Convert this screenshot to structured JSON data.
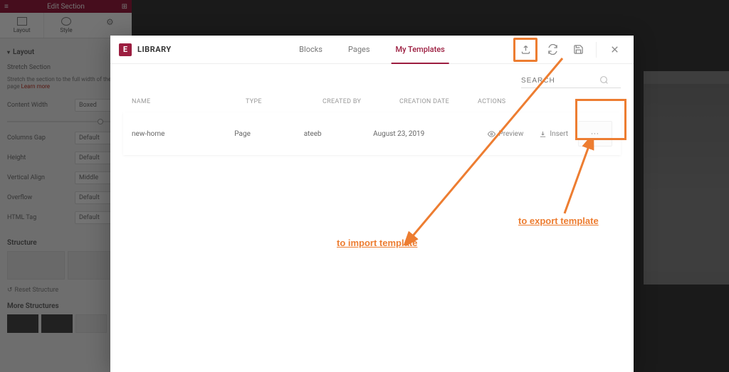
{
  "editor": {
    "header_title": "Edit Section",
    "tabs": {
      "layout": "Layout",
      "style": "Style",
      "advanced": ""
    },
    "section_title": "Layout",
    "stretch_label": "Stretch Section",
    "stretch_desc": "Stretch the section to the full width of the page",
    "learn_more": "Learn more",
    "fields": {
      "content_width": {
        "label": "Content Width",
        "value": "Boxed"
      },
      "columns_gap": {
        "label": "Columns Gap",
        "value": "Default"
      },
      "height": {
        "label": "Height",
        "value": "Default"
      },
      "vertical_align": {
        "label": "Vertical Align",
        "value": "Middle"
      },
      "overflow": {
        "label": "Overflow",
        "value": "Default"
      },
      "html_tag": {
        "label": "HTML Tag",
        "value": "Default"
      }
    },
    "structure_title": "Structure",
    "reset_label": "Reset Structure",
    "more_structures": "More Structures"
  },
  "library": {
    "title": "LIBRARY",
    "tabs": {
      "blocks": "Blocks",
      "pages": "Pages",
      "my_templates": "My Templates"
    },
    "search_placeholder": "SEARCH",
    "columns": {
      "name": "NAME",
      "type": "TYPE",
      "created_by": "CREATED BY",
      "creation_date": "CREATION DATE",
      "actions": "ACTIONS"
    },
    "rows": [
      {
        "name": "new-home",
        "type": "Page",
        "created_by": "ateeb",
        "creation_date": "August 23, 2019",
        "preview_label": "Preview",
        "insert_label": "Insert",
        "more_label": "···"
      }
    ]
  },
  "annotations": {
    "import": "to import template",
    "export": "to export template"
  }
}
